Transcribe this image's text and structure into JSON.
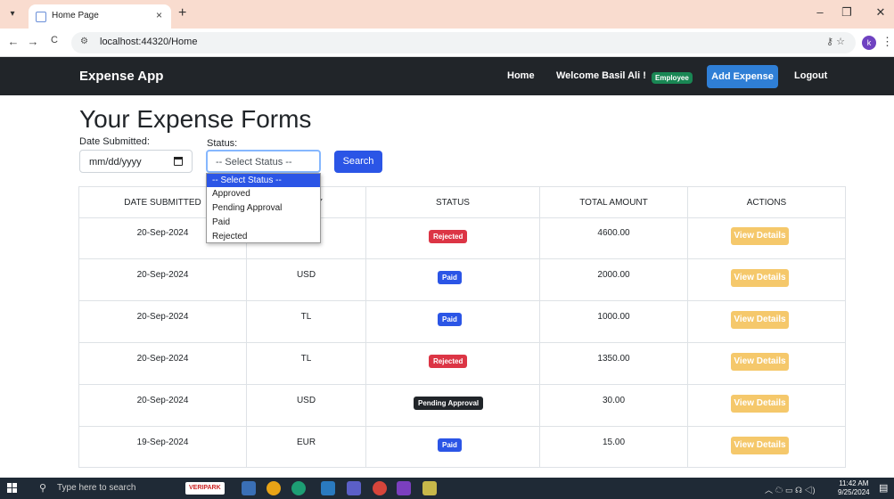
{
  "browser": {
    "tab_title": "Home Page",
    "tab_close": "×",
    "new_tab": "+",
    "url": "localhost:44320/Home",
    "profile_initial": "k",
    "controls": {
      "minimize": "–",
      "restore": "❐",
      "close": "✕",
      "back": "←",
      "forward": "→",
      "reload": "C",
      "menu": "⋮"
    }
  },
  "navbar": {
    "brand": "Expense App",
    "home": "Home",
    "welcome": "Welcome Basil Ali !",
    "role_badge": "Employee",
    "add_expense": "Add Expense",
    "logout": "Logout"
  },
  "page": {
    "title": "Your Expense Forms",
    "date_label": "Date Submitted:",
    "date_value": "mm/dd/yyyy",
    "status_label": "Status:",
    "status_selected": "-- Select Status --",
    "search_button": "Search"
  },
  "status_options": [
    "-- Select Status --",
    "Approved",
    "Pending Approval",
    "Paid",
    "Rejected"
  ],
  "table": {
    "headers": [
      "DATE SUBMITTED",
      "CY",
      "STATUS",
      "TOTAL AMOUNT",
      "ACTIONS"
    ],
    "action_label": "View Details",
    "rows": [
      {
        "date": "20-Sep-2024",
        "currency": "",
        "status": "Rejected",
        "amount": "4600.00"
      },
      {
        "date": "20-Sep-2024",
        "currency": "USD",
        "status": "Paid",
        "amount": "2000.00"
      },
      {
        "date": "20-Sep-2024",
        "currency": "TL",
        "status": "Paid",
        "amount": "1000.00"
      },
      {
        "date": "20-Sep-2024",
        "currency": "TL",
        "status": "Rejected",
        "amount": "1350.00"
      },
      {
        "date": "20-Sep-2024",
        "currency": "USD",
        "status": "Pending Approval",
        "amount": "30.00"
      },
      {
        "date": "19-Sep-2024",
        "currency": "EUR",
        "status": "Paid",
        "amount": "15.00"
      }
    ]
  },
  "taskbar": {
    "search_placeholder": "Type here to search",
    "veripark": "VERIPARK",
    "time": "11:42 AM",
    "date": "9/25/2024"
  },
  "colors": {
    "navbar": "#212529",
    "primary": "#2b55e6",
    "danger": "#dc3545",
    "warning": "#f5c86b",
    "success": "#198754"
  }
}
